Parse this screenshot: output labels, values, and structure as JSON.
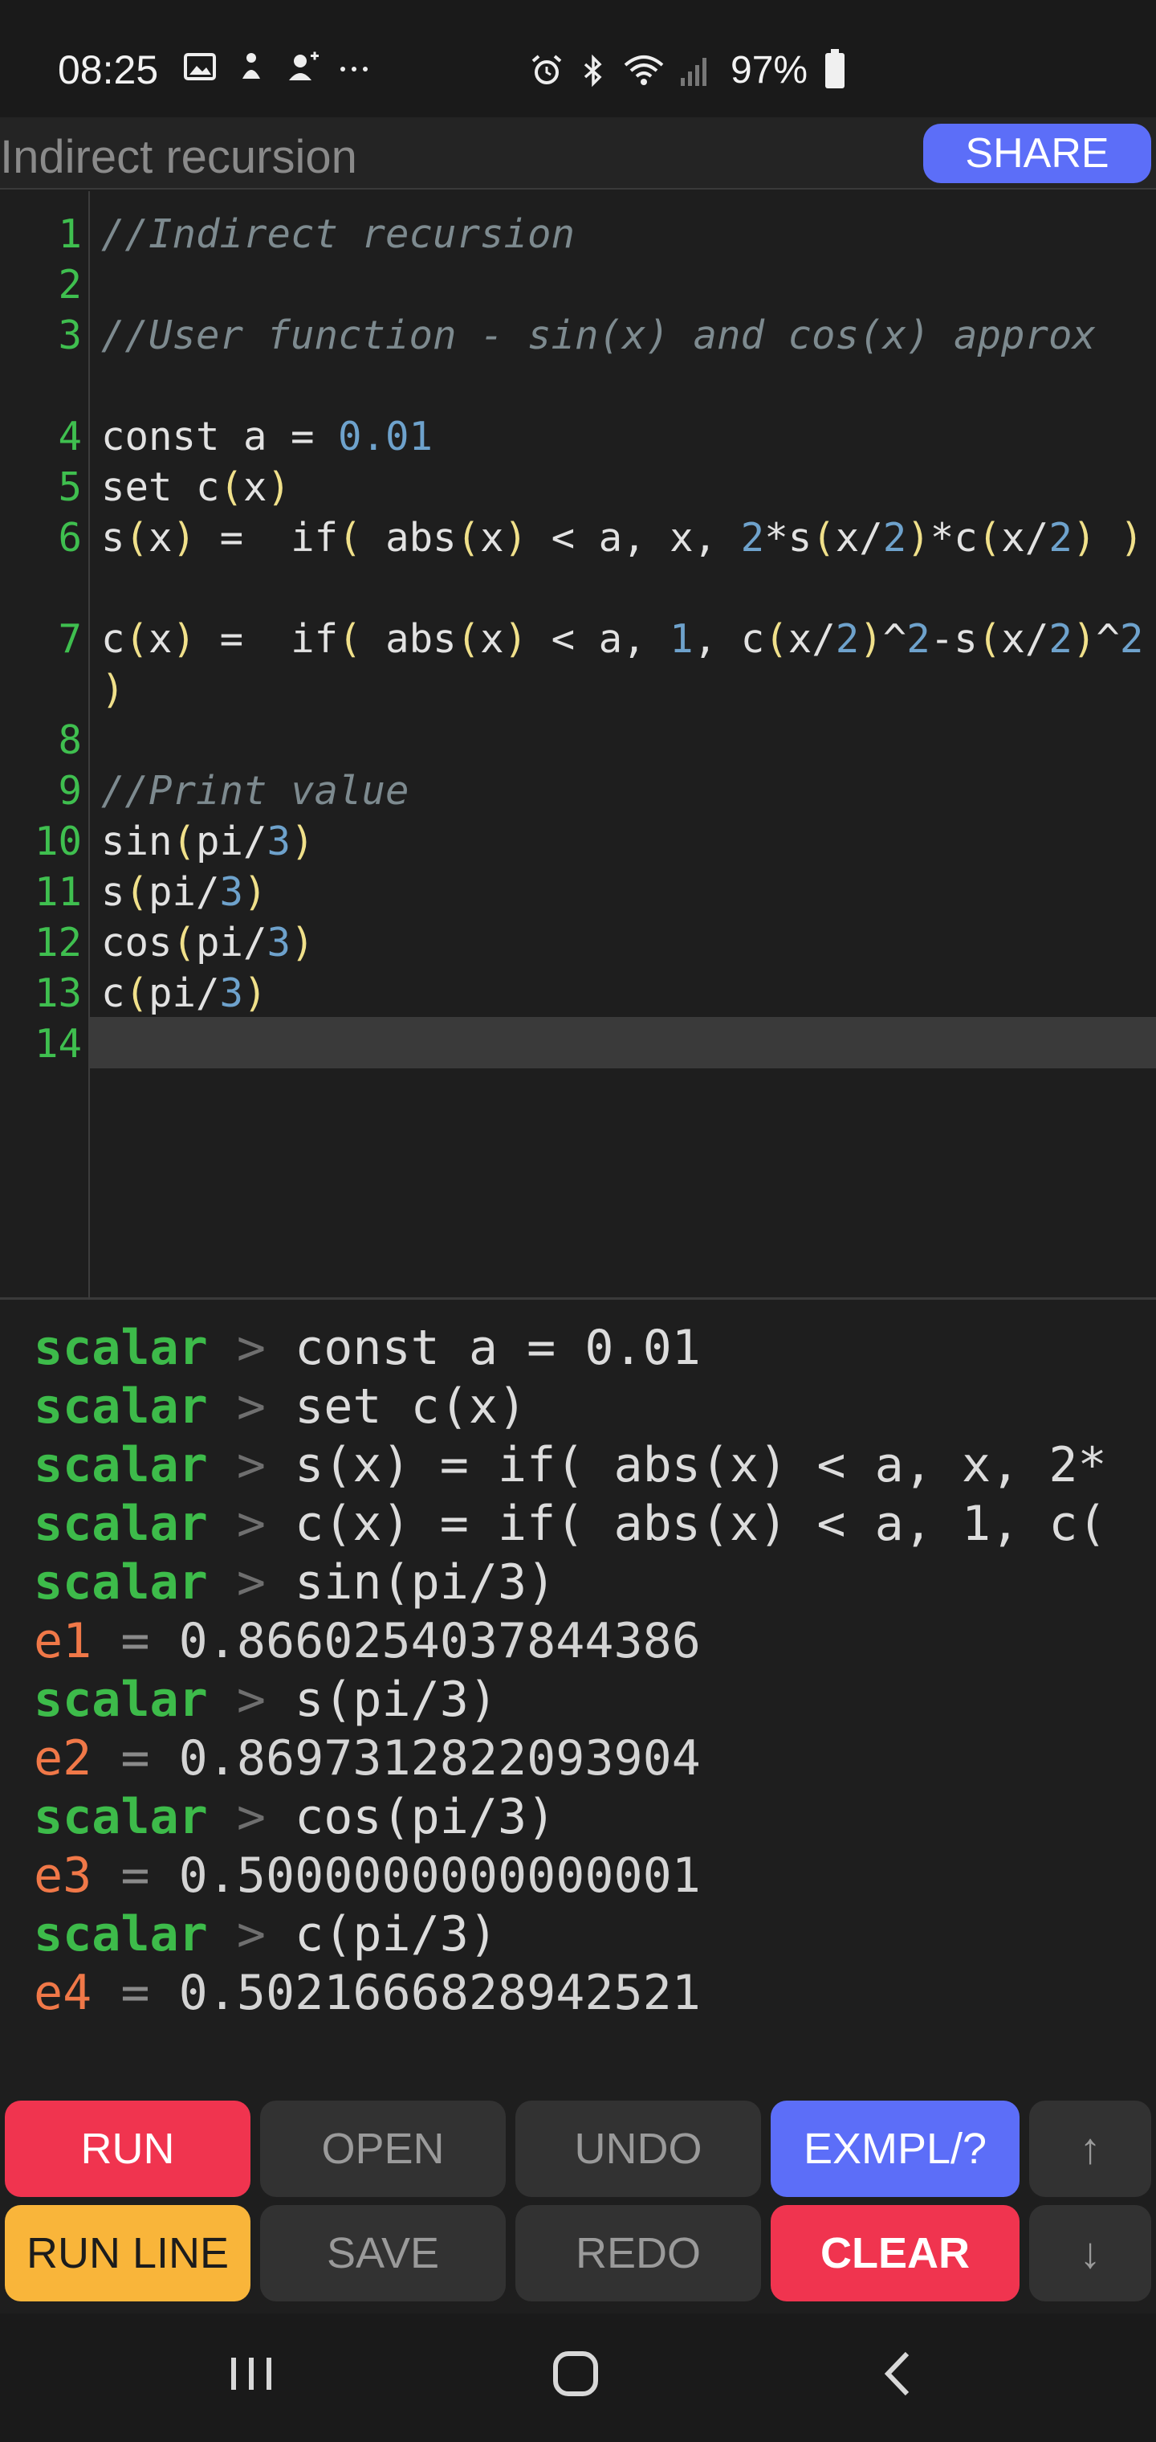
{
  "status_bar": {
    "time": "08:25",
    "battery": "97%",
    "left_icons": [
      "image-icon",
      "notification-icon",
      "person-add-icon",
      "more-icon"
    ],
    "right_icons": [
      "alarm-icon",
      "bluetooth-icon",
      "wifi-icon",
      "signal-icon",
      "battery-icon"
    ]
  },
  "title_bar": {
    "title": "Indirect recursion",
    "share_label": "SHARE"
  },
  "editor": {
    "line_numbers": [
      "1",
      "2",
      "3",
      "4",
      "5",
      "6",
      "7",
      "8",
      "9",
      "10",
      "11",
      "12",
      "13",
      "14"
    ],
    "lines": [
      "//Indirect recursion",
      "",
      "//User function - sin(x) and cos(x) approx",
      "const a = 0.01",
      "set c(x)",
      "s(x) =  if( abs(x) < a, x, 2*s(x/2)*c(x/2) )",
      "c(x) =  if( abs(x) < a, 1, c(x/2)^2-s(x/2)^2 )",
      "",
      "//Print value",
      "sin(pi/3)",
      "s(pi/3)",
      "cos(pi/3)",
      "c(pi/3)",
      ""
    ]
  },
  "console": {
    "prompt": "scalar",
    "arrow": ">",
    "entries": [
      {
        "type": "cmd",
        "text": "const a = 0.01"
      },
      {
        "type": "cmd",
        "text": "set c(x)"
      },
      {
        "type": "cmd",
        "text": "s(x) = if( abs(x) < a, x, 2*"
      },
      {
        "type": "cmd",
        "text": "c(x) = if( abs(x) < a, 1, c("
      },
      {
        "type": "cmd",
        "text": "sin(pi/3)"
      },
      {
        "type": "res",
        "var": "e1",
        "value": "0.8660254037844386"
      },
      {
        "type": "cmd",
        "text": "s(pi/3)"
      },
      {
        "type": "res",
        "var": "e2",
        "value": "0.8697312822093904"
      },
      {
        "type": "cmd",
        "text": "cos(pi/3)"
      },
      {
        "type": "res",
        "var": "e3",
        "value": "0.5000000000000001"
      },
      {
        "type": "cmd",
        "text": "c(pi/3)"
      },
      {
        "type": "res",
        "var": "e4",
        "value": "0.5021666828942521"
      }
    ]
  },
  "buttons": {
    "run": "RUN",
    "open": "OPEN",
    "undo": "UNDO",
    "exmpl": "EXMPL/?",
    "up": "↑",
    "run_line": "RUN LINE",
    "save": "SAVE",
    "redo": "REDO",
    "clear": "CLEAR",
    "down": "↓"
  },
  "colors": {
    "accent_blue": "#5c6ef8",
    "run_red": "#f0344f",
    "run_line_yellow": "#f9b53a",
    "prompt_green": "#3dbb4a",
    "result_orange": "#f07848"
  },
  "nav_bar": {
    "icons": [
      "recent-apps-icon",
      "home-icon",
      "back-icon"
    ]
  }
}
